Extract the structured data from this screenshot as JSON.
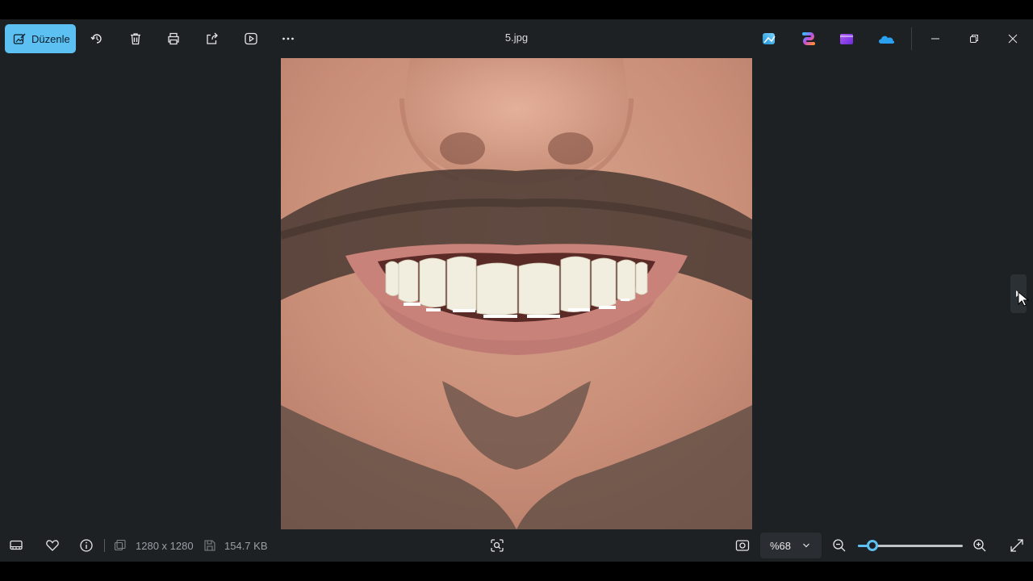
{
  "toolbar": {
    "edit_label": "Düzenle",
    "icons": [
      "rotate-icon",
      "delete-icon",
      "print-icon",
      "share-icon",
      "slideshow-icon",
      "more-icon"
    ]
  },
  "window": {
    "filename": "5.jpg",
    "app_icons": [
      "photos-editor-icon",
      "copilot-icon",
      "clipchamp-icon",
      "onedrive-icon"
    ]
  },
  "statusbar": {
    "dimensions": "1280 x 1280",
    "file_size": "154.7 KB",
    "zoom": "%68",
    "zoom_level": 0.14
  },
  "colors": {
    "accent": "#5cc0f2",
    "background": "#1d2124"
  }
}
